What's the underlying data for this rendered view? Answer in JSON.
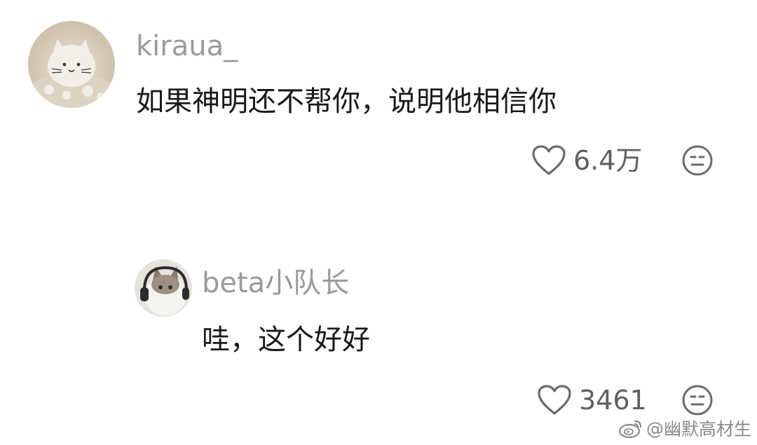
{
  "comments": [
    {
      "username": "kiraua_",
      "text": "如果神明还不帮你，说明他相信你",
      "likes": "6.4万",
      "avatar_icon": "cat-figurine-avatar",
      "reply": false
    },
    {
      "username": "beta小队长",
      "text": "哇，这个好好",
      "likes": "3461",
      "avatar_icon": "cat-headphones-avatar",
      "reply": true
    }
  ],
  "watermark": {
    "prefix": "@",
    "name": "幽默高材生",
    "icon": "weibo-logo-icon"
  },
  "colors": {
    "username": "#9a9a9a",
    "text": "#1a1a1a",
    "icon": "#6b6b6b"
  }
}
